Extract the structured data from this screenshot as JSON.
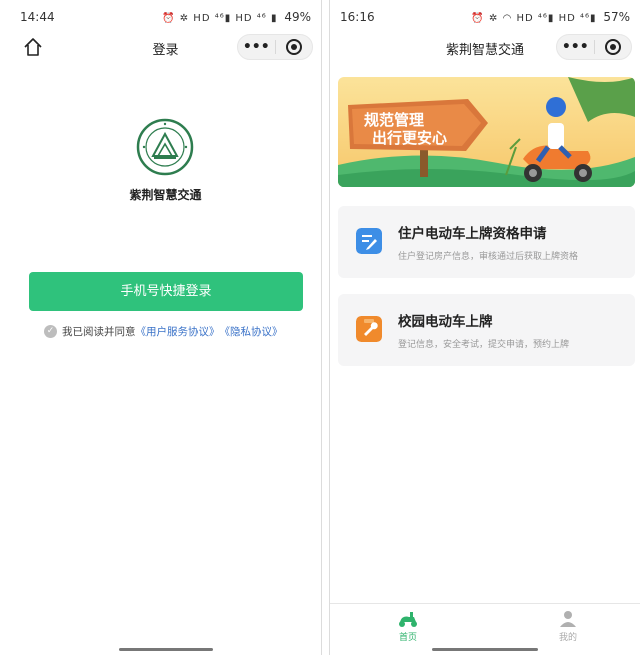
{
  "left": {
    "status": {
      "time": "14:44",
      "icons": "⏰ ✲ HD ⁴⁶▮ HD ⁴⁶ ▮",
      "battery": "49%"
    },
    "nav": {
      "title": "登录",
      "more": "•••"
    },
    "brand_name": "紫荆智慧交通",
    "login_button": "手机号快捷登录",
    "agreement": {
      "prefix": "我已阅读并同意",
      "user_agreement": "《用户服务协议》",
      "privacy_policy": "《隐私协议》"
    }
  },
  "right": {
    "status": {
      "time": "16:16",
      "icons": "⏰ ✲ ◠ HD ⁴⁶▮ HD ⁴⁶▮",
      "battery": "57%"
    },
    "nav": {
      "title": "紫荆智慧交通",
      "more": "•••"
    },
    "banner": {
      "line1": "规范管理",
      "line2": "出行更安心"
    },
    "cards": [
      {
        "title": "住户电动车上牌资格申请",
        "subtitle": "住户登记房产信息，审核通过后获取上牌资格",
        "icon": "edit-icon",
        "color": "#3d8ee6"
      },
      {
        "title": "校园电动车上牌",
        "subtitle": "登记信息，安全考试，提交申请，预约上牌",
        "icon": "wrench-icon",
        "color": "#f08a2c"
      }
    ],
    "tabs": [
      {
        "label": "首页",
        "icon": "scooter-icon",
        "active": true
      },
      {
        "label": "我的",
        "icon": "user-icon",
        "active": false
      }
    ]
  },
  "colors": {
    "primary_green": "#2fc27c",
    "link_blue": "#3a72c8",
    "tab_active": "#2fb36c"
  }
}
